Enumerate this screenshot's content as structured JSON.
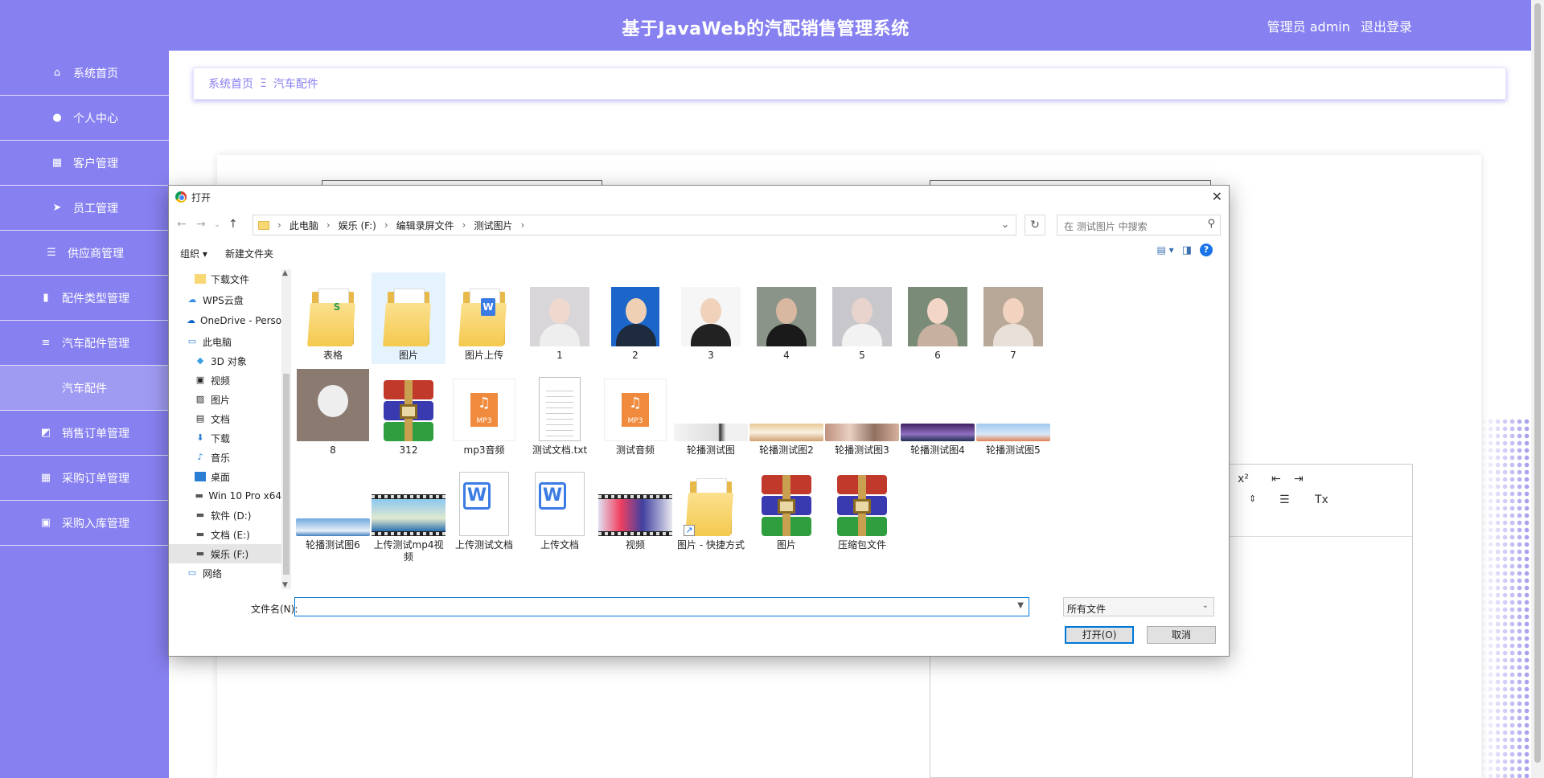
{
  "app": {
    "title": "基于JavaWeb的汽配销售管理系统",
    "user_role": "管理员 admin",
    "logout": "退出登录",
    "accent_color": "#8780f0"
  },
  "sidebar": {
    "items": [
      {
        "label": "系统首页",
        "icon": "home-icon"
      },
      {
        "label": "个人中心",
        "icon": "user-icon"
      },
      {
        "label": "客户管理",
        "icon": "grid-icon"
      },
      {
        "label": "员工管理",
        "icon": "send-icon"
      },
      {
        "label": "供应商管理",
        "icon": "sliders-icon"
      },
      {
        "label": "配件类型管理",
        "icon": "bar-chart-icon"
      },
      {
        "label": "汽车配件管理",
        "icon": "list-icon"
      },
      {
        "label": "汽车配件",
        "icon": ""
      },
      {
        "label": "销售订单管理",
        "icon": "line-chart-icon"
      },
      {
        "label": "采购订单管理",
        "icon": "table-icon"
      },
      {
        "label": "采购入库管理",
        "icon": "clipboard-icon"
      }
    ]
  },
  "breadcrumb": {
    "root": "系统首页",
    "separator": "Ξ",
    "current": "汽车配件"
  },
  "dialog": {
    "title": "打开",
    "path": [
      "此电脑",
      "娱乐 (F:)",
      "编辑录屏文件",
      "测试图片"
    ],
    "search_placeholder": "在 测试图片 中搜索",
    "organize": "组织 ▾",
    "new_folder": "新建文件夹",
    "nav_items": [
      {
        "label": "下载文件",
        "icon": "folder-icon"
      },
      {
        "label": "WPS云盘",
        "icon": "cloud-icon"
      },
      {
        "label": "OneDrive - Perso",
        "icon": "onedrive-icon"
      },
      {
        "label": "此电脑",
        "icon": "computer-icon"
      },
      {
        "label": "3D 对象",
        "icon": "cube-icon"
      },
      {
        "label": "视频",
        "icon": "video-icon"
      },
      {
        "label": "图片",
        "icon": "picture-icon"
      },
      {
        "label": "文档",
        "icon": "document-icon"
      },
      {
        "label": "下载",
        "icon": "download-icon"
      },
      {
        "label": "音乐",
        "icon": "music-icon"
      },
      {
        "label": "桌面",
        "icon": "desktop-icon"
      },
      {
        "label": "Win 10 Pro x64",
        "icon": "drive-icon"
      },
      {
        "label": "软件 (D:)",
        "icon": "drive-icon"
      },
      {
        "label": "文档 (E:)",
        "icon": "drive-icon"
      },
      {
        "label": "娱乐 (F:)",
        "icon": "drive-icon"
      },
      {
        "label": "网络",
        "icon": "network-icon"
      }
    ],
    "files": [
      {
        "name": "表格",
        "type": "folder",
        "badge": "S"
      },
      {
        "name": "图片",
        "type": "folder",
        "badge": ""
      },
      {
        "name": "图片上传",
        "type": "folder",
        "badge": "W"
      },
      {
        "name": "1",
        "type": "photo"
      },
      {
        "name": "2",
        "type": "photo"
      },
      {
        "name": "3",
        "type": "photo"
      },
      {
        "name": "4",
        "type": "photo"
      },
      {
        "name": "5",
        "type": "photo"
      },
      {
        "name": "6",
        "type": "photo"
      },
      {
        "name": "7",
        "type": "photo"
      },
      {
        "name": "8",
        "type": "photo"
      },
      {
        "name": "312",
        "type": "archive"
      },
      {
        "name": "mp3音频",
        "type": "audio",
        "tag": "MP3"
      },
      {
        "name": "测试文档.txt",
        "type": "text"
      },
      {
        "name": "测试音频",
        "type": "audio",
        "tag": "MP3"
      },
      {
        "name": "轮播测试图",
        "type": "banner"
      },
      {
        "name": "轮播测试图2",
        "type": "banner"
      },
      {
        "name": "轮播测试图3",
        "type": "banner"
      },
      {
        "name": "轮播测试图4",
        "type": "banner"
      },
      {
        "name": "轮播测试图5",
        "type": "banner"
      },
      {
        "name": "轮播测试图6",
        "type": "banner"
      },
      {
        "name": "上传测试mp4视频",
        "type": "video"
      },
      {
        "name": "上传测试文档",
        "type": "word"
      },
      {
        "name": "上传文档",
        "type": "word"
      },
      {
        "name": "视频",
        "type": "video"
      },
      {
        "name": "图片 - 快捷方式",
        "type": "shortcut"
      },
      {
        "name": "图片",
        "type": "archive"
      },
      {
        "name": "压缩包文件",
        "type": "archive"
      }
    ],
    "filename_label": "文件名(N):",
    "filename_value": "",
    "filetype": "所有文件",
    "open_button": "打开(O)",
    "cancel_button": "取消"
  },
  "editor": {
    "superscript": "x²",
    "clear_format": "Tx"
  }
}
